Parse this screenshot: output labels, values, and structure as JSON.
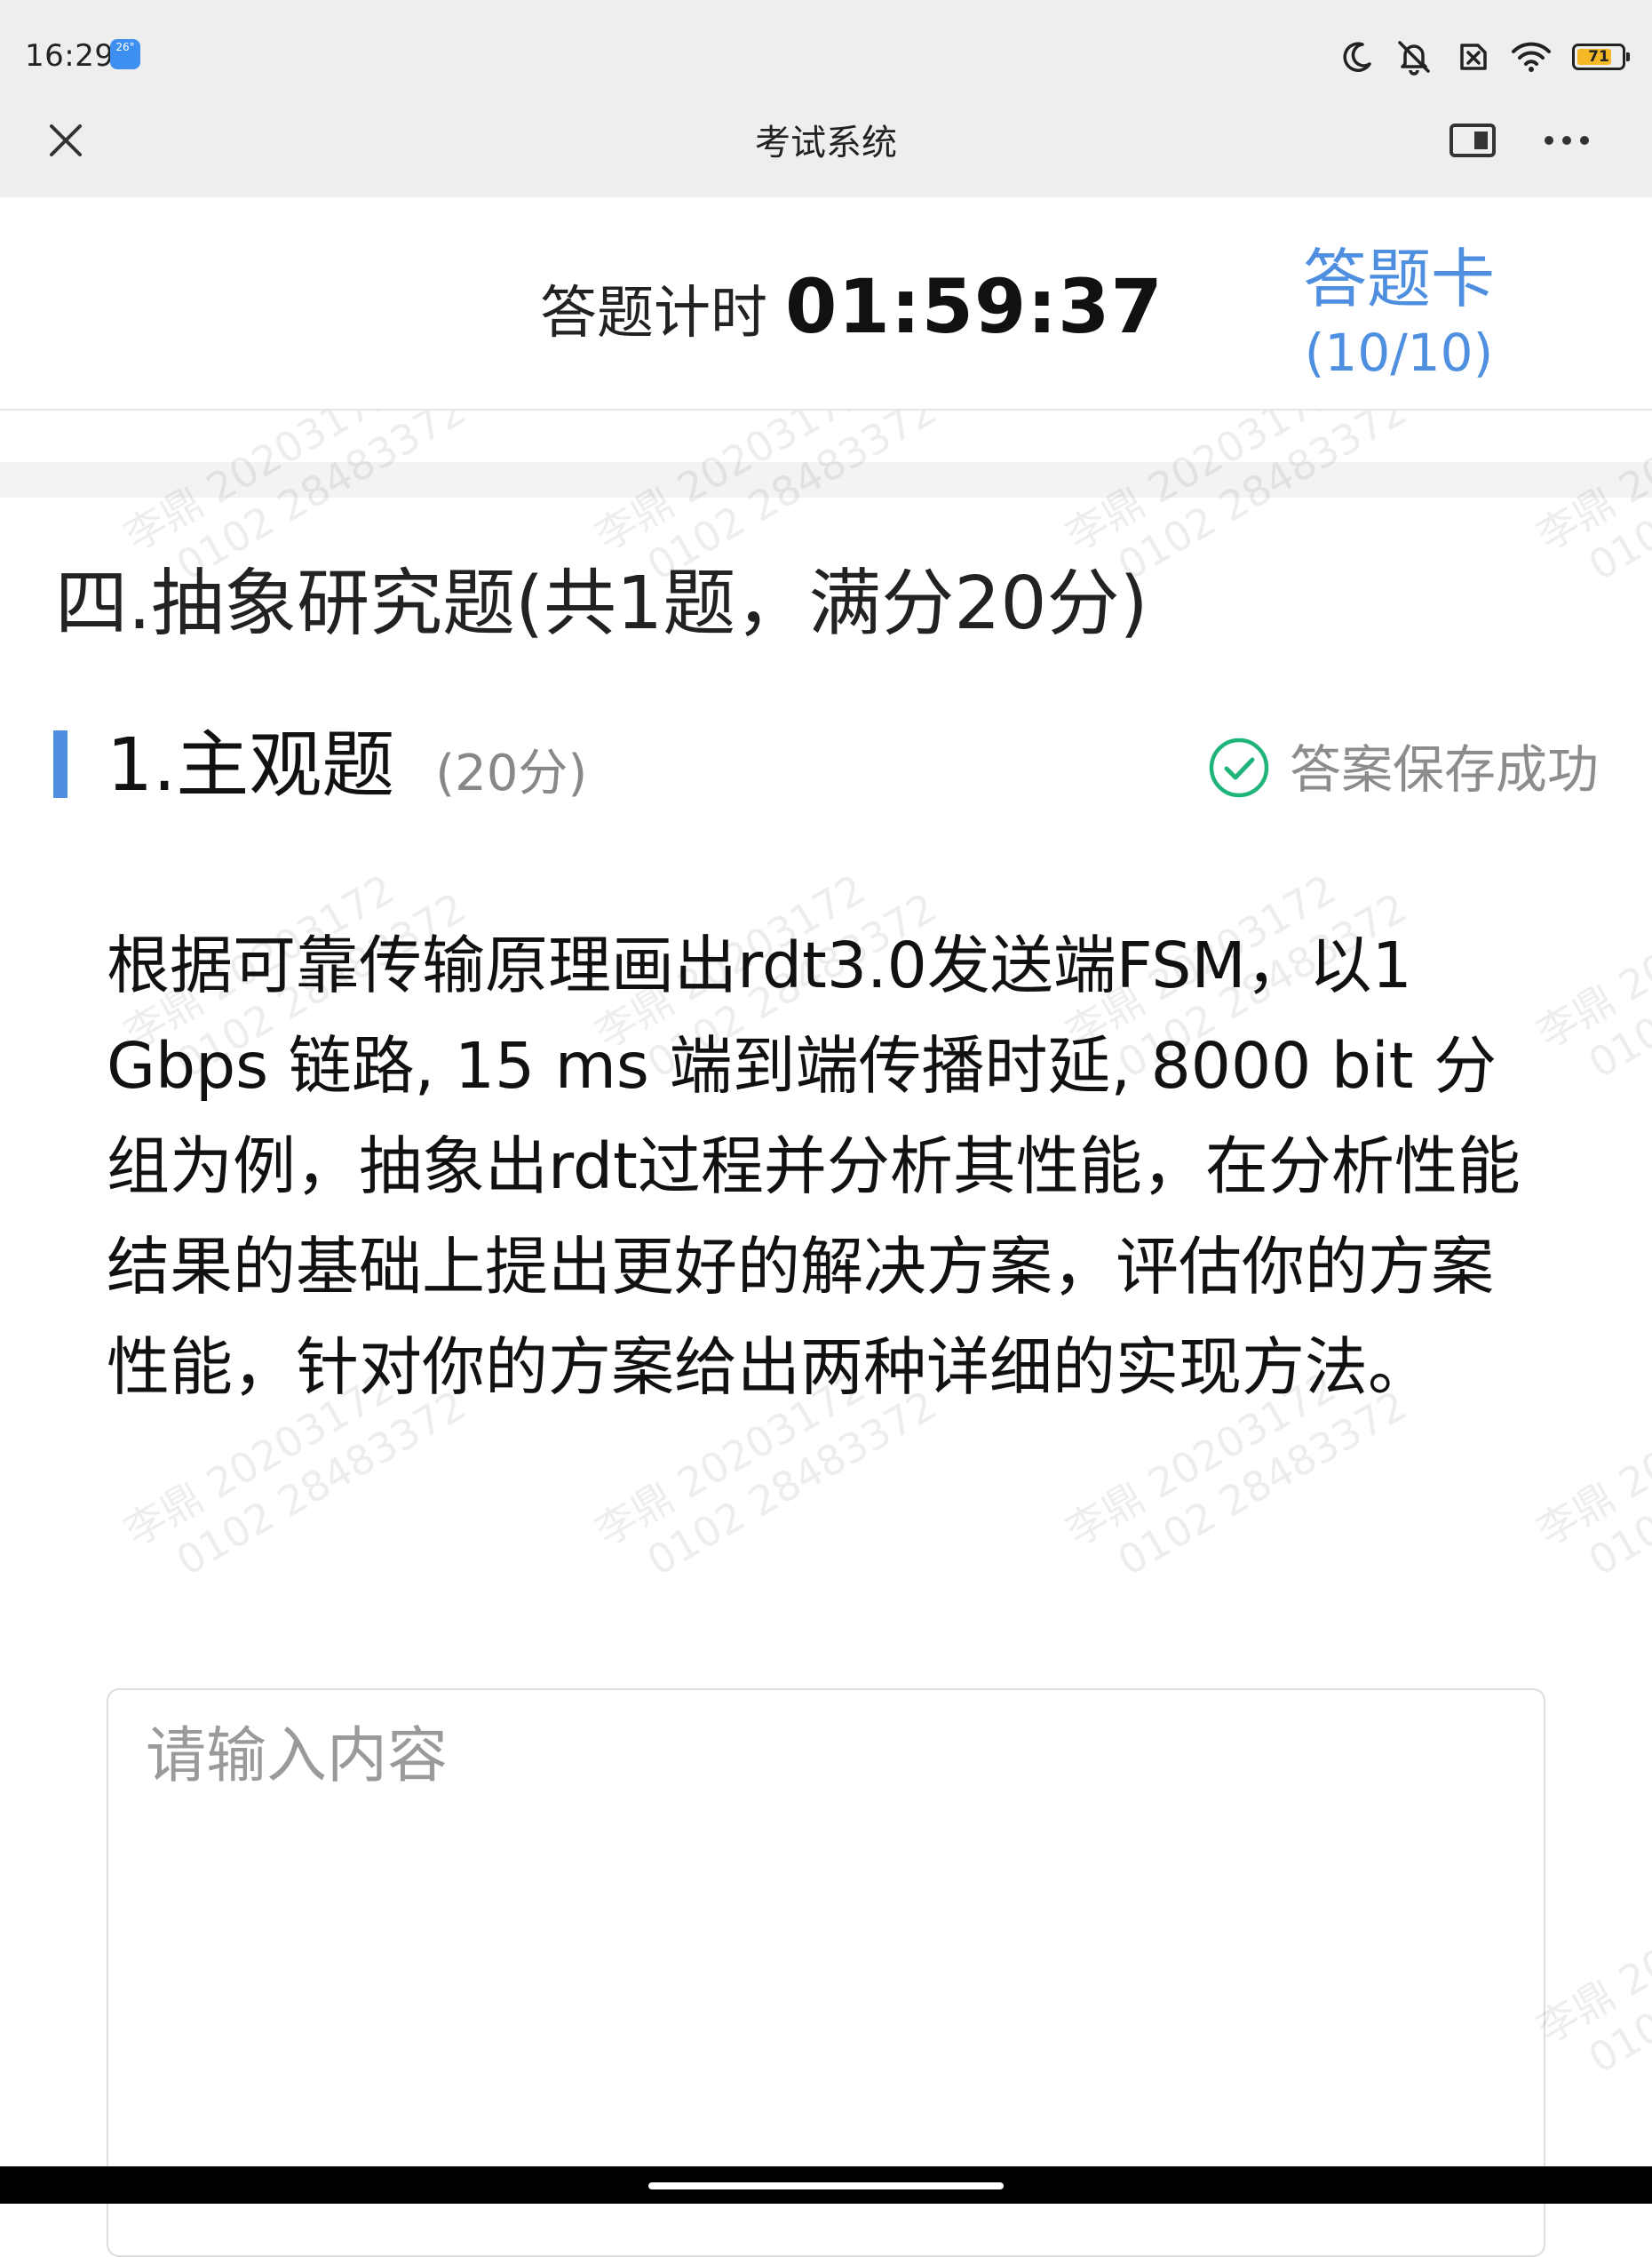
{
  "status_bar": {
    "time": "16:29",
    "weather": "26°",
    "battery_level": "71",
    "icons": [
      "moon-icon",
      "bell-muted-icon",
      "sim-off-icon",
      "wifi-icon",
      "battery-icon"
    ]
  },
  "title_bar": {
    "title": "考试系统",
    "icons": [
      "close-icon",
      "window-icon",
      "more-icon"
    ]
  },
  "timer": {
    "label": "答题计时",
    "value": "01:59:37"
  },
  "answer_card": {
    "label": "答题卡",
    "count": "(10/10)"
  },
  "section": {
    "title": "四.抽象研究题(共1题，满分20分)"
  },
  "question": {
    "title": "1.主观题",
    "score": "(20分)",
    "save_status": "答案保存成功",
    "body": "根据可靠传输原理画出rdt3.0发送端FSM，以1 Gbps 链路, 15 ms 端到端传播时延, 8000 bit 分组为例，抽象出rdt过程并分析其性能，在分析性能结果的基础上提出更好的解决方案，评估你的方案性能，针对你的方案给出两种详细的实现方法。"
  },
  "answer": {
    "placeholder": "请输入内容",
    "value": ""
  },
  "watermark": {
    "line1": "李鼎 20203172",
    "line2": "0102 28483372"
  },
  "colors": {
    "accent": "#4f8fe0",
    "success": "#1fb57a",
    "battery": "#f3b824",
    "title_bar_bg": "#eeeeee"
  }
}
